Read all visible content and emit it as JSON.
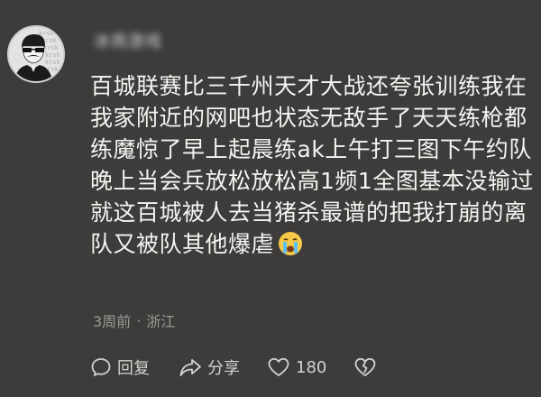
{
  "comment": {
    "username": "冰雨游戏",
    "body_lines": [
      "百城联赛比三千州天才大战还夸张训练我在",
      "我家附近的网吧也状态无敌手了天天练枪都",
      "练魔惊了早上起晨练ak上午打三图下午约队",
      "晚上当会兵放松放松高1频1全图基本没输过",
      "就这百城被人去当猪杀最谱的把我打崩的离",
      "队又被队其他爆虐"
    ],
    "emoji": "crying-face-emoji",
    "time": "3周前",
    "separator": "·",
    "location": "浙江",
    "avatar_watermark": "krsk"
  },
  "actions": {
    "reply_label": "回复",
    "share_label": "分享",
    "like_count": "180"
  },
  "colors": {
    "background": "#3d3c3a",
    "text": "#f4f4f2",
    "meta": "#9a9996",
    "icon": "#d2d2d0"
  }
}
